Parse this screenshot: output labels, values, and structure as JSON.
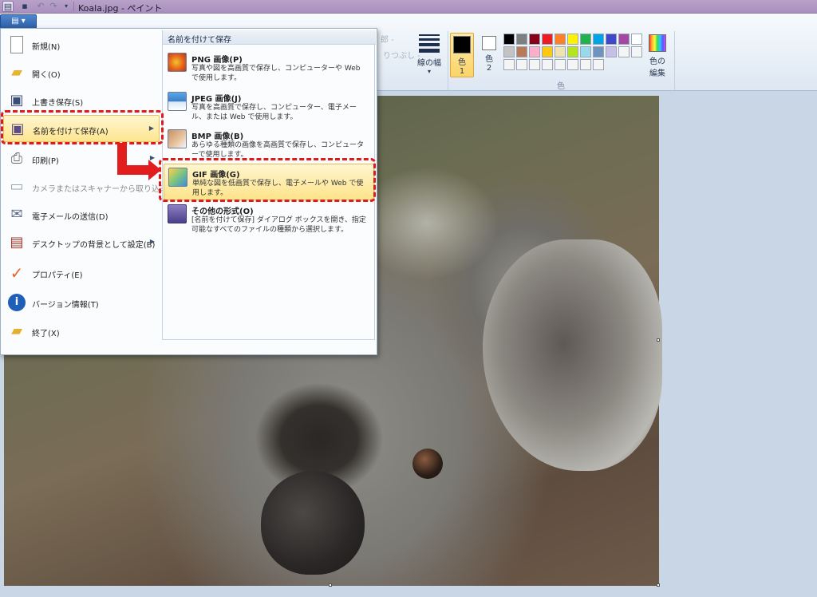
{
  "window": {
    "title": "Koala.jpg - ペイント"
  },
  "quick_access": {
    "save_icon": "save-icon",
    "undo_icon": "undo-icon",
    "redo_icon": "redo-icon",
    "customize_icon": "dropdown-icon"
  },
  "ribbon": {
    "file_tab_label": "",
    "faded_text_1": "郎 -",
    "faded_text_2": "りつぶし -",
    "width_label": "線の幅",
    "color1_label_top": "色",
    "color1_label_bottom": "1",
    "color2_label_top": "色",
    "color2_label_bottom": "2",
    "colors_group_caption": "色",
    "edit_colors_top": "色の",
    "edit_colors_bottom": "編集",
    "color1": "#000000",
    "color2": "#ffffff",
    "palette": [
      "#000000",
      "#7f7f7f",
      "#880015",
      "#ed1c24",
      "#ff7f27",
      "#fff200",
      "#22b14c",
      "#00a2e8",
      "#3f48cc",
      "#a349a4",
      "#ffffff",
      "#c3c3c3",
      "#b97a57",
      "#ffaec9",
      "#ffc90e",
      "#efe4b0",
      "#b5e61d",
      "#99d9ea",
      "#7092be",
      "#c8bfe7",
      "#f5f5f5",
      "#f5f5f5",
      "#f5f5f5",
      "#f5f5f5",
      "#f5f5f5",
      "#f5f5f5",
      "#f5f5f5",
      "#f5f5f5",
      "#f5f5f5",
      "#f5f5f5"
    ]
  },
  "file_menu": {
    "items": [
      {
        "label": "新規(N)",
        "icon": "new-document-icon"
      },
      {
        "label": "開く(O)",
        "icon": "open-folder-icon"
      },
      {
        "label": "上書き保存(S)",
        "icon": "save-icon"
      },
      {
        "label": "名前を付けて保存(A)",
        "icon": "save-as-icon"
      },
      {
        "label": "印刷(P)",
        "icon": "printer-icon"
      },
      {
        "label": "カメラまたはスキャナーから取り込み(M)",
        "icon": "scanner-icon"
      },
      {
        "label": "電子メールの送信(D)",
        "icon": "email-icon"
      },
      {
        "label": "デスクトップの背景として設定(B)",
        "icon": "desktop-icon"
      },
      {
        "label": "プロパティ(E)",
        "icon": "checkmark-icon"
      },
      {
        "label": "バージョン情報(T)",
        "icon": "info-icon"
      },
      {
        "label": "終了(X)",
        "icon": "exit-icon"
      }
    ],
    "submenu": {
      "header": "名前を付けて保存",
      "items": [
        {
          "title": "PNG 画像(P)",
          "desc": "写真や図を高画質で保存し、コンピューターや Web で使用します。"
        },
        {
          "title": "JPEG 画像(J)",
          "desc": "写真を高画質で保存し、コンピューター、電子メール、または Web で使用します。"
        },
        {
          "title": "BMP 画像(B)",
          "desc": "あらゆる種類の画像を高画質で保存し、コンピューターで使用します。"
        },
        {
          "title": "GIF 画像(G)",
          "desc": "単純な図を低画質で保存し、電子メールや Web で使用します。"
        },
        {
          "title": "その他の形式(O)",
          "desc": "[名前を付けて保存] ダイアログ ボックスを開き、指定可能なすべてのファイルの種類から選択します。"
        }
      ]
    }
  }
}
